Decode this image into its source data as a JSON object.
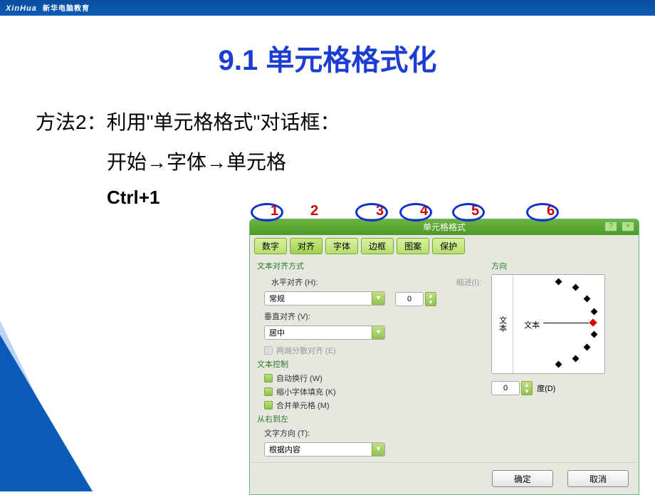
{
  "topbar": {
    "brand": "XinHua",
    "brand_cn": "新华电脑教育"
  },
  "title": "9.1  单元格格式化",
  "method": {
    "line1": "方法2：利用\"单元格格式\"对话框：",
    "line2": "开始→字体→单元格",
    "shortcut": "Ctrl+1"
  },
  "annotations": [
    "1",
    "2",
    "3",
    "4",
    "5",
    "6"
  ],
  "dialog": {
    "title": "单元格格式",
    "help": "?",
    "close": "×",
    "tabs": [
      "数字",
      "对齐",
      "字体",
      "边框",
      "图案",
      "保护"
    ],
    "active_tab": 1,
    "section_align": "文本对齐方式",
    "h_label": "水平对齐 (H):",
    "h_value": "常规",
    "indent_label": "缩进(I):",
    "indent_value": "0",
    "v_label": "垂直对齐 (V):",
    "v_value": "居中",
    "justify": "两端分散对齐 (E)",
    "section_ctrl": "文本控制",
    "wrap": "自动换行 (W)",
    "shrink": "缩小字体填充 (K)",
    "merge": "合并单元格 (M)",
    "section_rtl": "从右到左",
    "dir_label": "文字方向 (T):",
    "dir_value": "根据内容",
    "orient_label": "方向",
    "orient_vtext": "文本",
    "orient_htext": "文本",
    "degree_value": "0",
    "degree_label": "度(D)",
    "ok": "确定",
    "cancel": "取消"
  }
}
